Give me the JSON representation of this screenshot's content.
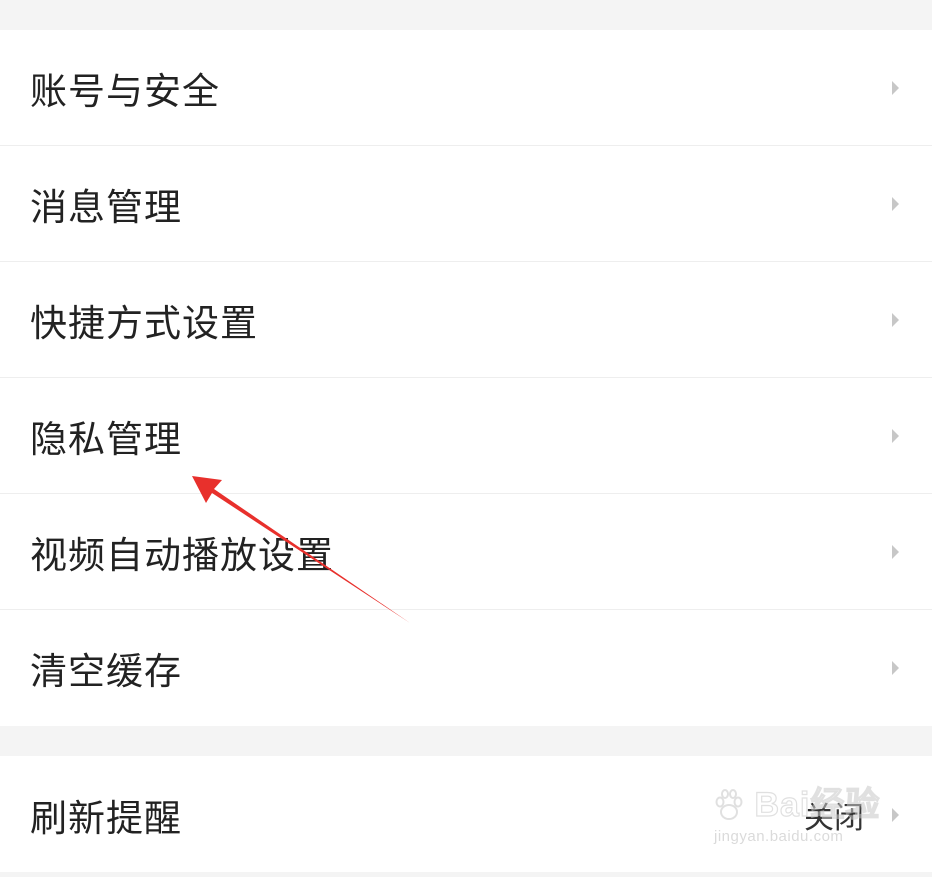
{
  "settings": {
    "items": [
      {
        "label": "账号与安全",
        "icon": "chevron-right-icon"
      },
      {
        "label": "消息管理",
        "icon": "chevron-right-icon"
      },
      {
        "label": "快捷方式设置",
        "icon": "chevron-right-icon"
      },
      {
        "label": "隐私管理",
        "icon": "chevron-right-icon"
      },
      {
        "label": "视频自动播放设置",
        "icon": "chevron-right-icon"
      },
      {
        "label": "清空缓存",
        "icon": "chevron-right-icon"
      }
    ],
    "refresh": {
      "label": "刷新提醒",
      "value": "关闭",
      "icon": "chevron-right-icon"
    }
  },
  "annotation": {
    "arrow_color": "#e8302c"
  },
  "watermark": {
    "brand": "Bai经验",
    "url": "jingyan.baidu.com"
  },
  "colors": {
    "background": "#f4f4f4",
    "row": "#ffffff",
    "text": "#222222",
    "chevron": "#c7c7c7"
  }
}
